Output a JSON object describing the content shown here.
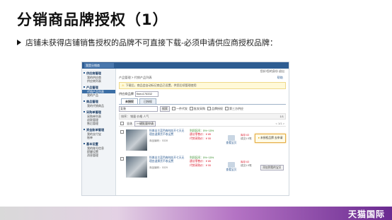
{
  "slide": {
    "title": "分销商品牌授权（1）",
    "bullet": "店铺未获得店铺销售授权的品牌不可直接下载-必须申请供应商授权品牌："
  },
  "app": {
    "brand_label": "我是分销商",
    "top_right_links": "您好!您的身份  退出",
    "breadcrumb": "产品管理 > 代销产品列表",
    "help_link": "帮助",
    "notice": "下载后，商品会自动标记商品已设置，供您后续管理使用",
    "supplier_label": "供应商品牌",
    "supplier_value": "fineo176332",
    "tabs": [
      "未授权",
      "已授权"
    ],
    "search_value": "女装",
    "search_button": "搜索",
    "filter_options": [
      "一件代发",
      "批发采购",
      "品牌授权",
      "第三方供应"
    ],
    "sort_label": "排序：  销量  价格  人气",
    "sort_pager": "1/1",
    "list_select_all": "全选",
    "list_batch_button": "一键批量申请",
    "list_pager": "< 1/1 >",
    "footer_brand": "天猫国际"
  },
  "sidebar": {
    "sections": [
      {
        "title": "供应商管理",
        "items": [
          "我的供应商",
          "供应商列表"
        ]
      },
      {
        "title": "产品管理",
        "items": [
          "代销产品列表",
          "我的产品"
        ],
        "active": 0
      },
      {
        "title": "商品管理",
        "items": [
          "我的代销商品"
        ]
      },
      {
        "title": "采购单管理",
        "items": [
          "采购单列表",
          "退款管理",
          "售后管理"
        ]
      },
      {
        "title": "资金账单管理",
        "items": [
          "我的支付宝",
          "账单"
        ]
      },
      {
        "title": "基本设置",
        "items": [
          "我的账号信息",
          "提醒设置",
          "消息管理"
        ]
      }
    ]
  },
  "products": [
    {
      "title": "怡美自主蓝色梅纯花开七天无理由退换货不收运费",
      "meta": "商品编码：5328",
      "profit": "利润区间：5%~15%",
      "price_suggest": "建议零售价：¥ 85",
      "price_agent": "代销采购价：¥ 55",
      "look": "查看宝贝",
      "status_1": "库存 63",
      "status_2": "成交1 0笔",
      "action": "未授权品牌  去申请"
    },
    {
      "title": "怡美自主蓝色梅纯花开七天无理由退换货不收运费",
      "meta": "商品编码：5329",
      "profit": "利润区间：5%~15%",
      "price_suggest": "建议零售价：¥ 85",
      "price_agent": "代销采购价：¥ 55",
      "look": "查看宝贝",
      "status_1": "库存 63",
      "status_2": "成交1 0笔",
      "action": "添加到我的宝贝"
    }
  ]
}
